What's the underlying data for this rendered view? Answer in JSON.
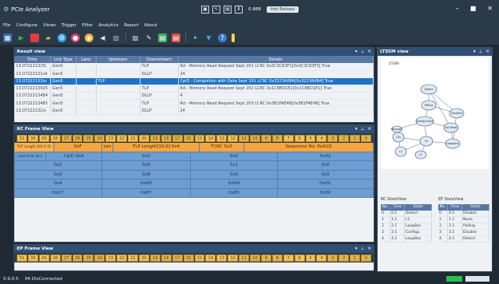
{
  "app": {
    "title": "PCIe Analyzer"
  },
  "center_tools": {
    "label": "0.888",
    "hot_reload": "Hot Reload"
  },
  "menu": [
    "File",
    "Configure",
    "Views",
    "Trigger",
    "Filter",
    "Analytics",
    "Report",
    "About"
  ],
  "result_view": {
    "title": "Result view",
    "columns": [
      "Time",
      "Link Type",
      "Lane",
      "Upstream",
      "Downstream",
      "Details"
    ],
    "rows": [
      {
        "time": "13.0722213/31",
        "link": "Gen5",
        "lane": "",
        "up": "",
        "down": "TLP",
        "details": "Rd - Memory Read Request Sept 201 LCRC 0x3C3C83F1[0x3C3C83F3] True"
      },
      {
        "time": "13.07222131s4",
        "link": "Gen5",
        "lane": "",
        "up": "",
        "down": "DLLP",
        "details": "24"
      },
      {
        "time": "13.07222131ts",
        "link": "Gen5",
        "lane": "",
        "up": "TLP",
        "down": "",
        "details": "CplD - Completion with Data Sept 201 LCRC 0x3223A0B4[0x3223A0B4] True"
      },
      {
        "time": "13.0722213425",
        "link": "Gen5",
        "lane": "",
        "up": "",
        "down": "TLP",
        "details": "Rd - Memory Read Request Sept 202 LCRC 0x1C8BD1E1[0x1C8BD1E1] True"
      },
      {
        "time": "13.0722213484",
        "link": "Gen5",
        "lane": "",
        "up": "",
        "down": "DLLP",
        "details": "4"
      },
      {
        "time": "13.0722213485",
        "link": "Gen5",
        "lane": "",
        "up": "",
        "down": "TLP",
        "details": "Rd - Memory Read Request Sept 203 LCRC 0x3B1FAE48[0x3B1FAE48] True"
      },
      {
        "time": "13.07222131/s",
        "link": "Gen5",
        "lane": "",
        "up": "",
        "down": "DLLP",
        "details": "24"
      },
      {
        "time": "",
        "link": "",
        "lane": "",
        "up": "",
        "down": "",
        "details": ""
      }
    ]
  },
  "rc_frame": {
    "title": "RC Frame View",
    "bits": [
      "31",
      "30",
      "29",
      "28",
      "27",
      "26",
      "25",
      "24",
      "23",
      "22",
      "21",
      "20",
      "19",
      "18",
      "17",
      "16",
      "15",
      "14",
      "13",
      "12",
      "11",
      "10",
      "9",
      "8",
      "7",
      "6",
      "5",
      "4",
      "3",
      "2",
      "1",
      "0"
    ],
    "header_row": [
      "TLP Length (bit 0-3)",
      "0xF",
      "Len",
      "TLP Length[10:0] 0x4",
      "FCRC 0x3",
      "Sequence No. 0xA1D"
    ],
    "rows": [
      [
        "Last Ordr 0x3",
        "CplD 0xA",
        "0x0",
        "0x0",
        "0x42"
      ],
      [
        "0x2",
        "0x8",
        "0x1",
        "0x0"
      ],
      [
        "0x3",
        "0x8",
        "0x5",
        "0x0"
      ],
      [
        "0x4",
        "0x6D",
        "0xD8",
        "0xDC"
      ],
      [
        "0xD7",
        "0x87",
        "0x05",
        "0x50"
      ]
    ]
  },
  "ep_frame": {
    "title": "EP Frame View",
    "bits": [
      "31",
      "30",
      "29",
      "28",
      "27",
      "26",
      "25",
      "24",
      "23",
      "22",
      "21",
      "20",
      "19",
      "18",
      "17",
      "16",
      "15",
      "14",
      "13",
      "12",
      "11",
      "10",
      "9",
      "8",
      "7",
      "6",
      "5",
      "4",
      "3",
      "2",
      "1",
      "0"
    ]
  },
  "ltssm": {
    "title": "LTSSM view",
    "graph_title": "LTSSM",
    "states": [
      "Detect",
      "Polling",
      "Disabled",
      "Configuration",
      "Hot Reset",
      "Loopback",
      "L0",
      "L0s",
      "L1",
      "L2",
      "Recovery"
    ],
    "rc_list": {
      "title": "RC StateView",
      "columns": [
        "No.",
        "Time",
        "State"
      ],
      "rows": [
        [
          "0",
          "0.1",
          "Detect"
        ],
        [
          "1",
          "1.1",
          "L1"
        ],
        [
          "2",
          "2.1",
          "LoopBac"
        ],
        [
          "3",
          "3.1",
          "Configu"
        ],
        [
          "4",
          "4.1",
          "LoopBac"
        ]
      ]
    },
    "ep_list": {
      "title": "EP StateView",
      "columns": [
        "No.",
        "Time",
        "State"
      ],
      "rows": [
        [
          "0",
          "0.1",
          "Disable"
        ],
        [
          "1",
          "1.1",
          "None"
        ],
        [
          "2",
          "2.1",
          "Polling"
        ],
        [
          "3",
          "3.1",
          "Disable"
        ],
        [
          "4",
          "4.1",
          "Detect"
        ]
      ]
    }
  },
  "status": {
    "version": "0.9.0.5",
    "connection": "PA DisConnected"
  },
  "colors": {
    "accent": "#2f4f74",
    "header": "#5878a4",
    "selected": "#1f73c6",
    "bits": "#f2c15a",
    "frame": "#6c9dd3",
    "orange": "#f4a640"
  }
}
